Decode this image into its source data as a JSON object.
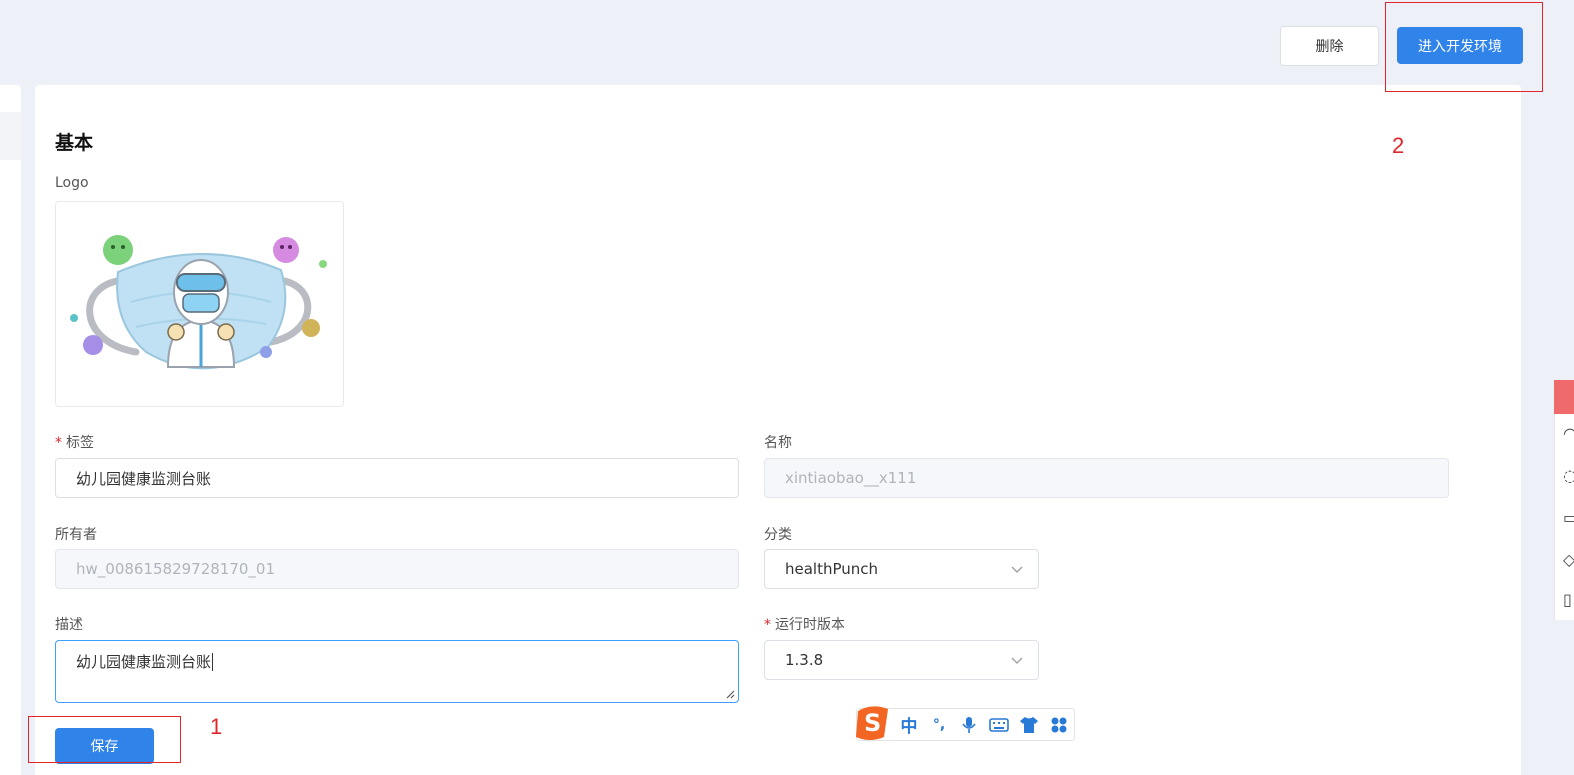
{
  "header": {
    "delete_label": "删除",
    "enter_dev_label": "进入开发环境"
  },
  "annotations": {
    "marker_1": "1",
    "marker_2": "2"
  },
  "section": {
    "title": "基本",
    "logo_label": "Logo"
  },
  "form": {
    "tag": {
      "label": "标签",
      "required": "*",
      "value": "幼儿园健康监测台账"
    },
    "name": {
      "label": "名称",
      "value": "xintiaobao__x111"
    },
    "owner": {
      "label": "所有者",
      "value": "hw_008615829728170_01"
    },
    "category": {
      "label": "分类",
      "value": "healthPunch"
    },
    "description": {
      "label": "描述",
      "value": "幼儿园健康监测台账"
    },
    "runtime": {
      "label": "运行时版本",
      "required": "*",
      "value": "1.3.8"
    }
  },
  "actions": {
    "save_label": "保存"
  },
  "ime": {
    "mode": "中",
    "punct": "°,"
  },
  "colors": {
    "primary": "#2f83e9",
    "annotation_red": "#e0262b",
    "page_bg": "#edf1f7"
  }
}
